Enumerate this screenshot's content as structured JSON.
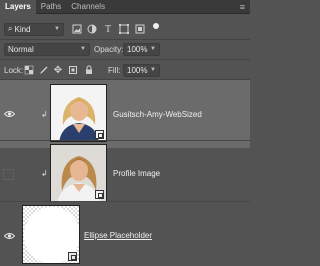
{
  "tabs": [
    {
      "label": "Layers",
      "active": true
    },
    {
      "label": "Paths",
      "active": false
    },
    {
      "label": "Channels",
      "active": false
    }
  ],
  "filter": {
    "kind_label": "Kind",
    "icons": [
      "image-filter-icon",
      "adjustment-filter-icon",
      "type-filter-icon",
      "shape-filter-icon",
      "smart-object-filter-icon",
      "filter-toggle-icon"
    ]
  },
  "blend": {
    "mode": "Normal",
    "opacity_label": "Opacity:",
    "opacity_value": "100%"
  },
  "lock": {
    "label": "Lock:",
    "fill_label": "Fill:",
    "fill_value": "100%"
  },
  "layers": [
    {
      "name": "Gusitsch-Amy-WebSized",
      "visible": true,
      "selected": true,
      "linked": true,
      "smart_object": true
    },
    {
      "name": "Profile Image",
      "visible": false,
      "selected": false,
      "linked": true,
      "smart_object": true
    },
    {
      "name": "Ellipse Placeholder",
      "visible": true,
      "selected": false,
      "linked": false,
      "smart_object": false,
      "underlined": true
    }
  ],
  "colors": {
    "panel_bg": "#535353",
    "selected_row": "#6b6b6b",
    "tabbar_bg": "#3a3a3a"
  }
}
